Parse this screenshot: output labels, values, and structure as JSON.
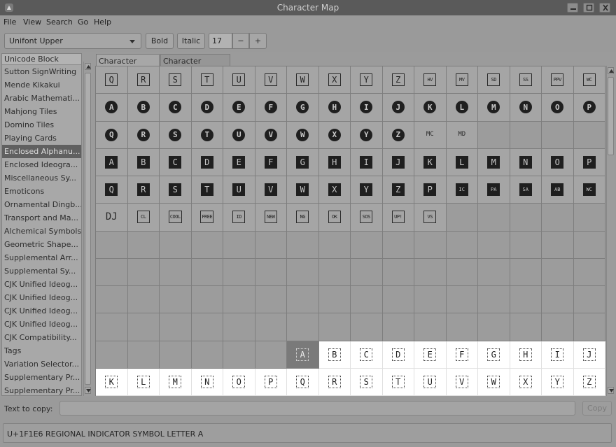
{
  "window": {
    "title": "Character Map",
    "app_icon_glyph": "▲",
    "controls": [
      "minimize",
      "maximize",
      "close"
    ]
  },
  "menu": [
    "File",
    "View",
    "Search",
    "Go",
    "Help"
  ],
  "toolbar": {
    "font": "Unifont Upper",
    "bold": "Bold",
    "italic": "Italic",
    "size": "17",
    "minus": "−",
    "plus": "+"
  },
  "blocks": {
    "header": "Unicode Block",
    "selected_index": 6,
    "items": [
      "Sutton SignWriting",
      "Mende Kikakui",
      "Arabic Mathemati...",
      "Mahjong Tiles",
      "Domino Tiles",
      "Playing Cards",
      "Enclosed Alphanu...",
      "Enclosed Ideogra...",
      "Miscellaneous Sy...",
      "Emoticons",
      "Ornamental Dingb...",
      "Transport and Ma...",
      "Alchemical Symbols",
      "Geometric Shape...",
      "Supplemental Arr...",
      "Supplemental Sy...",
      "CJK Unified Ideog...",
      "CJK Unified Ideog...",
      "CJK Unified Ideog...",
      "CJK Unified Ideog...",
      "CJK Compatibility...",
      "Tags",
      "Variation Selector...",
      "Supplementary Pr...",
      "Supplementary Pr..."
    ]
  },
  "tabs": [
    "Character Table",
    "Character Details"
  ],
  "grid": {
    "rows": [
      [
        [
          "sq",
          "Q"
        ],
        [
          "sq",
          "R"
        ],
        [
          "sq",
          "S"
        ],
        [
          "sq",
          "T"
        ],
        [
          "sq",
          "U"
        ],
        [
          "sq",
          "V"
        ],
        [
          "sq",
          "W"
        ],
        [
          "sq",
          "X"
        ],
        [
          "sq",
          "Y"
        ],
        [
          "sq",
          "Z"
        ],
        [
          "sqs",
          "HV"
        ],
        [
          "sqs",
          "MV"
        ],
        [
          "sqs",
          "SD"
        ],
        [
          "sqs",
          "SS"
        ],
        [
          "sqs",
          "PPV"
        ],
        [
          "sqs",
          "WC"
        ]
      ],
      [
        [
          "circ",
          "A"
        ],
        [
          "circ",
          "B"
        ],
        [
          "circ",
          "C"
        ],
        [
          "circ",
          "D"
        ],
        [
          "circ",
          "E"
        ],
        [
          "circ",
          "F"
        ],
        [
          "circ",
          "G"
        ],
        [
          "circ",
          "H"
        ],
        [
          "circ",
          "I"
        ],
        [
          "circ",
          "J"
        ],
        [
          "circ",
          "K"
        ],
        [
          "circ",
          "L"
        ],
        [
          "circ",
          "M"
        ],
        [
          "circ",
          "N"
        ],
        [
          "circ",
          "O"
        ],
        [
          "circ",
          "P"
        ]
      ],
      [
        [
          "circ",
          "Q"
        ],
        [
          "circ",
          "R"
        ],
        [
          "circ",
          "S"
        ],
        [
          "circ",
          "T"
        ],
        [
          "circ",
          "U"
        ],
        [
          "circ",
          "V"
        ],
        [
          "circ",
          "W"
        ],
        [
          "circ",
          "X"
        ],
        [
          "circ",
          "Y"
        ],
        [
          "circ",
          "Z"
        ],
        [
          "plainsmall",
          "MC"
        ],
        [
          "plainsmall",
          "MD"
        ],
        [
          "empty",
          ""
        ],
        [
          "empty",
          ""
        ],
        [
          "empty",
          ""
        ],
        [
          "empty",
          ""
        ]
      ],
      [
        [
          "neg",
          "A"
        ],
        [
          "neg",
          "B"
        ],
        [
          "neg",
          "C"
        ],
        [
          "neg",
          "D"
        ],
        [
          "neg",
          "E"
        ],
        [
          "neg",
          "F"
        ],
        [
          "neg",
          "G"
        ],
        [
          "neg",
          "H"
        ],
        [
          "neg",
          "I"
        ],
        [
          "neg",
          "J"
        ],
        [
          "neg",
          "K"
        ],
        [
          "neg",
          "L"
        ],
        [
          "neg",
          "M"
        ],
        [
          "neg",
          "N"
        ],
        [
          "neg",
          "O"
        ],
        [
          "neg",
          "P"
        ]
      ],
      [
        [
          "neg",
          "Q"
        ],
        [
          "neg",
          "R"
        ],
        [
          "neg",
          "S"
        ],
        [
          "neg",
          "T"
        ],
        [
          "neg",
          "U"
        ],
        [
          "neg",
          "V"
        ],
        [
          "neg",
          "W"
        ],
        [
          "neg",
          "X"
        ],
        [
          "neg",
          "Y"
        ],
        [
          "neg",
          "Z"
        ],
        [
          "neg",
          "P"
        ],
        [
          "negs",
          "IC"
        ],
        [
          "negs",
          "PA"
        ],
        [
          "negs",
          "SA"
        ],
        [
          "negs",
          "AB"
        ],
        [
          "negs",
          "WC"
        ]
      ],
      [
        [
          "plain",
          "DJ"
        ],
        [
          "sqs",
          "CL"
        ],
        [
          "sqs",
          "COOL"
        ],
        [
          "sqs",
          "FREE"
        ],
        [
          "sqs",
          "ID"
        ],
        [
          "sqs",
          "NEW"
        ],
        [
          "sqs",
          "NG"
        ],
        [
          "sqs",
          "OK"
        ],
        [
          "sqs",
          "SOS"
        ],
        [
          "sqs",
          "UP!"
        ],
        [
          "sqs",
          "VS"
        ],
        [
          "empty",
          ""
        ],
        [
          "empty",
          ""
        ],
        [
          "empty",
          ""
        ],
        [
          "empty",
          ""
        ],
        [
          "empty",
          ""
        ]
      ],
      [
        [
          "empty",
          ""
        ],
        [
          "empty",
          ""
        ],
        [
          "empty",
          ""
        ],
        [
          "empty",
          ""
        ],
        [
          "empty",
          ""
        ],
        [
          "empty",
          ""
        ],
        [
          "empty",
          ""
        ],
        [
          "empty",
          ""
        ],
        [
          "empty",
          ""
        ],
        [
          "empty",
          ""
        ],
        [
          "empty",
          ""
        ],
        [
          "empty",
          ""
        ],
        [
          "empty",
          ""
        ],
        [
          "empty",
          ""
        ],
        [
          "empty",
          ""
        ],
        [
          "empty",
          ""
        ]
      ],
      [
        [
          "empty",
          ""
        ],
        [
          "empty",
          ""
        ],
        [
          "empty",
          ""
        ],
        [
          "empty",
          ""
        ],
        [
          "empty",
          ""
        ],
        [
          "empty",
          ""
        ],
        [
          "empty",
          ""
        ],
        [
          "empty",
          ""
        ],
        [
          "empty",
          ""
        ],
        [
          "empty",
          ""
        ],
        [
          "empty",
          ""
        ],
        [
          "empty",
          ""
        ],
        [
          "empty",
          ""
        ],
        [
          "empty",
          ""
        ],
        [
          "empty",
          ""
        ],
        [
          "empty",
          ""
        ]
      ],
      [
        [
          "empty",
          ""
        ],
        [
          "empty",
          ""
        ],
        [
          "empty",
          ""
        ],
        [
          "empty",
          ""
        ],
        [
          "empty",
          ""
        ],
        [
          "empty",
          ""
        ],
        [
          "empty",
          ""
        ],
        [
          "empty",
          ""
        ],
        [
          "empty",
          ""
        ],
        [
          "empty",
          ""
        ],
        [
          "empty",
          ""
        ],
        [
          "empty",
          ""
        ],
        [
          "empty",
          ""
        ],
        [
          "empty",
          ""
        ],
        [
          "empty",
          ""
        ],
        [
          "empty",
          ""
        ]
      ],
      [
        [
          "empty",
          ""
        ],
        [
          "empty",
          ""
        ],
        [
          "empty",
          ""
        ],
        [
          "empty",
          ""
        ],
        [
          "empty",
          ""
        ],
        [
          "empty",
          ""
        ],
        [
          "empty",
          ""
        ],
        [
          "empty",
          ""
        ],
        [
          "empty",
          ""
        ],
        [
          "empty",
          ""
        ],
        [
          "empty",
          ""
        ],
        [
          "empty",
          ""
        ],
        [
          "empty",
          ""
        ],
        [
          "empty",
          ""
        ],
        [
          "empty",
          ""
        ],
        [
          "empty",
          ""
        ]
      ],
      [
        [
          "empty",
          ""
        ],
        [
          "empty",
          ""
        ],
        [
          "empty",
          ""
        ],
        [
          "empty",
          ""
        ],
        [
          "empty",
          ""
        ],
        [
          "empty",
          ""
        ],
        [
          "sel",
          "A"
        ],
        [
          "hl",
          "B"
        ],
        [
          "hl",
          "C"
        ],
        [
          "hl",
          "D"
        ],
        [
          "hl",
          "E"
        ],
        [
          "hl",
          "F"
        ],
        [
          "hl",
          "G"
        ],
        [
          "hl",
          "H"
        ],
        [
          "hl",
          "I"
        ],
        [
          "hl",
          "J"
        ]
      ],
      [
        [
          "hl",
          "K"
        ],
        [
          "hl",
          "L"
        ],
        [
          "hl",
          "M"
        ],
        [
          "hl",
          "N"
        ],
        [
          "hl",
          "O"
        ],
        [
          "hl",
          "P"
        ],
        [
          "hl",
          "Q"
        ],
        [
          "hl",
          "R"
        ],
        [
          "hl",
          "S"
        ],
        [
          "hl",
          "T"
        ],
        [
          "hl",
          "U"
        ],
        [
          "hl",
          "V"
        ],
        [
          "hl",
          "W"
        ],
        [
          "hl",
          "X"
        ],
        [
          "hl",
          "Y"
        ],
        [
          "hl",
          "Z"
        ]
      ]
    ]
  },
  "bottom": {
    "copy_label": "Text to copy:",
    "copy_value": "",
    "copy_button": "Copy",
    "status": "U+1F1E6 REGIONAL INDICATOR SYMBOL LETTER A"
  }
}
